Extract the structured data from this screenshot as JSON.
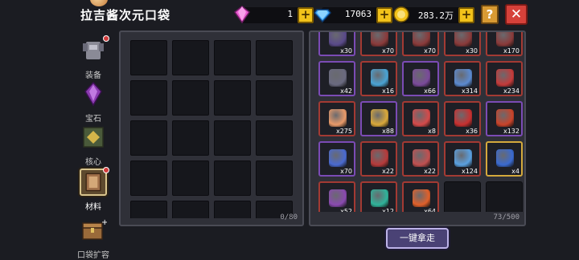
{
  "title": "拉吉酱次元口袋",
  "resources": {
    "gems": "1",
    "diamonds": "17063",
    "coins": "283.2万"
  },
  "buttons": {
    "help": "?",
    "close": "✕",
    "plus": "+",
    "take_all": "一键拿走"
  },
  "sidebar": [
    {
      "label": "装备",
      "badge": true
    },
    {
      "label": "宝石",
      "badge": false
    },
    {
      "label": "核心",
      "badge": false
    },
    {
      "label": "材料",
      "badge": true,
      "selected": true
    },
    {
      "label": "口袋扩容",
      "badge": false
    }
  ],
  "left_panel": {
    "count": "0/80"
  },
  "right_panel": {
    "count": "73/500",
    "items": [
      {
        "q": "x30",
        "rarity": "purple",
        "icon": "partial-item-icon",
        "color": "#5a4a8a"
      },
      {
        "q": "x70",
        "rarity": "red",
        "icon": "partial-item-icon",
        "color": "#8a3a3a"
      },
      {
        "q": "x70",
        "rarity": "red",
        "icon": "partial-item-icon",
        "color": "#8a3a3a"
      },
      {
        "q": "x30",
        "rarity": "red",
        "icon": "partial-item-icon",
        "color": "#8a3a3a"
      },
      {
        "q": "x170",
        "rarity": "red",
        "icon": "partial-item-icon",
        "color": "#8a3a3a"
      },
      {
        "q": "x42",
        "rarity": "purple",
        "icon": "rock-icon",
        "color": "#6a6a80"
      },
      {
        "q": "x16",
        "rarity": "red",
        "icon": "crossbow-icon",
        "color": "#4aa3d4"
      },
      {
        "q": "x66",
        "rarity": "purple",
        "icon": "purple-part-icon",
        "color": "#7a4a9a"
      },
      {
        "q": "x314",
        "rarity": "red",
        "icon": "target-orb-icon",
        "color": "#5b8ad0"
      },
      {
        "q": "x234",
        "rarity": "red",
        "icon": "red-part-icon",
        "color": "#c43a3a"
      },
      {
        "q": "x275",
        "rarity": "red",
        "icon": "ore-pile-icon",
        "color": "#e89a6a"
      },
      {
        "q": "x88",
        "rarity": "purple",
        "icon": "gold-cube-icon",
        "color": "#d9a83a"
      },
      {
        "q": "x8",
        "rarity": "red",
        "icon": "red-blade-icon",
        "color": "#d44a4a"
      },
      {
        "q": "x36",
        "rarity": "red",
        "icon": "red-canister-icon",
        "color": "#c83030"
      },
      {
        "q": "x132",
        "rarity": "purple",
        "icon": "red-disc-icon",
        "color": "#c9432a"
      },
      {
        "q": "x70",
        "rarity": "purple",
        "icon": "blue-shield-icon",
        "color": "#4a6ad0"
      },
      {
        "q": "x22",
        "rarity": "red",
        "icon": "red-chunk-icon",
        "color": "#b63a3a"
      },
      {
        "q": "x22",
        "rarity": "red",
        "icon": "metal-part-icon",
        "color": "#c05050"
      },
      {
        "q": "x124",
        "rarity": "red",
        "icon": "energy-core-icon",
        "color": "#5aa0e0"
      },
      {
        "q": "x4",
        "rarity": "gold",
        "icon": "blue-potion-icon",
        "color": "#3a6ad0"
      },
      {
        "q": "x52",
        "rarity": "red",
        "icon": "spider-core-icon",
        "color": "#8a4ab0"
      },
      {
        "q": "x12",
        "rarity": "red",
        "icon": "cloth-bundle-icon",
        "color": "#2fb39a"
      },
      {
        "q": "x64",
        "rarity": "red",
        "icon": "pumpkin-icon",
        "color": "#e0602a"
      },
      {
        "q": "",
        "rarity": "empty"
      },
      {
        "q": "",
        "rarity": "empty"
      }
    ]
  },
  "colors": {
    "plus_button": "#f2c21a",
    "close_button": "#d6413a",
    "take_button": "#4a4275"
  }
}
